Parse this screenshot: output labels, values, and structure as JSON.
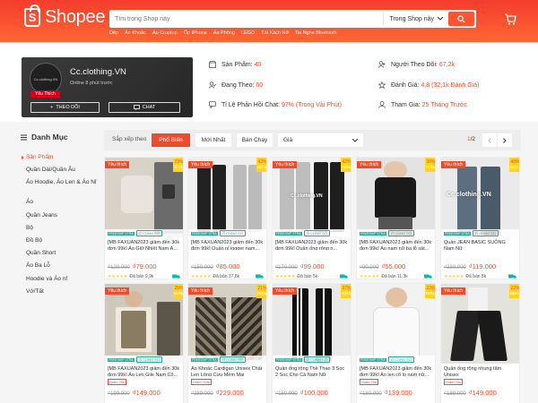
{
  "header": {
    "logo_text": "Shopee",
    "search_placeholder": "Tìm trong Shop này",
    "search_scope": "Trong Shop này",
    "hot_keywords": [
      "Dép",
      "Áo Khoác",
      "Áo Croptop",
      "Ốp iPhone",
      "Áo Phông",
      "LEGO",
      "Túi Xách Nữ",
      "Tai Nghe Bluetooth"
    ]
  },
  "shop": {
    "avatar_text": "Cc.clothing.VN",
    "favorite_badge": "Yêu Thích",
    "name": "Cc.clothing.VN",
    "online": "Online 8 phút trước",
    "follow_label": "THEO DÕI",
    "chat_label": "CHAT",
    "stats": [
      {
        "label": "Sản Phẩm: ",
        "value": "40",
        "icon": "store-icon"
      },
      {
        "label": "Người Theo Dõi: ",
        "value": "67,2k",
        "icon": "followers-icon"
      },
      {
        "label": "Đang Theo: ",
        "value": "60",
        "icon": "following-icon"
      },
      {
        "label": "Đánh Giá: ",
        "value": "4.8 (32,1k Đánh Giá)",
        "icon": "star-icon"
      },
      {
        "label": "Tỉ Lệ Phản Hồi Chat: ",
        "value": "97% (Trong Vài Phút)",
        "icon": "chat-rate-icon"
      },
      {
        "label": "Tham Gia: ",
        "value": "25 Tháng Trước",
        "icon": "joined-icon"
      }
    ]
  },
  "sidebar": {
    "title": "Danh Mục",
    "items": [
      "Sản Phẩm",
      "Quần Dài/Quần Âu",
      "Áo Hoodie, Áo Len & Áo Nỉ",
      "Áo",
      "Quần Jeans",
      "Bộ",
      "Đồ Bộ",
      "Quần Short",
      "Áo Ba Lỗ",
      "Hoodie và Áo nỉ",
      "Vớ/Tất"
    ]
  },
  "sort": {
    "label": "Sắp xếp theo",
    "options": [
      "Phổ Biến",
      "Mới Nhất",
      "Bán Chạy"
    ],
    "active": "Phổ Biến",
    "price_select": "Giá",
    "page_current": "1",
    "page_total": "/2"
  },
  "accent": "#ee4d2d",
  "products": [
    {
      "title": "[MB FAXUAN2023 giảm đến 30k đơn 99k] Áo Giữ Nhiệt Nam Á...",
      "fav": "Yêu thích",
      "discount": "23%",
      "disc_word": "GIẢM",
      "free_ship": "FREESHIP XTRA",
      "badge": "Ở CÙNG SỐ",
      "old": "₫129.000",
      "price": "₫79.000",
      "sold": "Đã bán 9,9k",
      "vouchers": []
    },
    {
      "title": "[MB FAXUAN2023 giảm đến 30k đơn 99k] Quần nỉ jogger nam...",
      "fav": "Yêu thích",
      "discount": "43%",
      "disc_word": "GIẢM",
      "free_ship": "FREESHIP XTRA",
      "badge": "Ở CÙNG SỐ",
      "old": "₫150.000",
      "price": "₫85.000",
      "sold": "Đã bán 37,8k",
      "vouchers": []
    },
    {
      "title": "[MB FAXUAN2023 giảm đến 30k đơn 99k] Quần ống rộng n...",
      "fav": "Yêu thích",
      "discount": "42%",
      "disc_word": "GIẢM",
      "free_ship": "FREESHIP XTRA",
      "badge": "Ở CÙNG SỐ",
      "old": "₫170.000",
      "price": "₫99.000",
      "sold": "Đã bán 5k",
      "vouchers": []
    },
    {
      "title": "[MB FAXUAN2023 giảm đến 30k đơn 99k] Áo nam nữ ba lỗ sát...",
      "fav": "Yêu thích",
      "discount": "38%",
      "disc_word": "GIẢM",
      "free_ship": "FREESHIP XTRA",
      "badge": "Ở CÙNG SỐ",
      "old": "₫90.000",
      "price": "₫55.000",
      "sold": "Đã bán 11,3k",
      "vouchers": []
    },
    {
      "title": "Quần JEAN BASIC SUÔNG Nam Nữ",
      "fav": "Yêu thích",
      "discount": "48%",
      "disc_word": "GIẢM",
      "free_ship": "FREESHIP XTRA",
      "badge": "Ở CÙNG SỐ",
      "old": "₫230.000",
      "price": "₫119.000",
      "sold": "Đã bán 8k",
      "vouchers": []
    },
    {
      "title": "[MB FAXUAN2023 giảm đến 30k đơn 99k] Áo Len Gile Nam Cổ...",
      "fav": "Yêu thích",
      "discount": "25%",
      "disc_word": "GIẢM",
      "free_ship": "FREESHIP XTRA",
      "badge": "Ở CÙNG SỐ",
      "old": "₫199.000",
      "price": "₫149.000",
      "sold": "",
      "vouchers": [
        "Giảm ₫5k"
      ]
    },
    {
      "title": "Áo Khoác Cardigan Unisex Chất Len Lông Cừu Mềm Mại",
      "fav": "Yêu thích",
      "discount": "21%",
      "disc_word": "GIẢM",
      "free_ship": "FREESHIP XTRA",
      "badge": "Ở CÙNG SỐ",
      "old": "₫289.000",
      "price": "₫229.000",
      "sold": "",
      "vouchers": [
        "Giảm ₫10k"
      ]
    },
    {
      "title": "Quần ống rộng Thể Thao 3 Sọc 2 Sọc Cho Cả Nam Nữ",
      "fav": "Yêu thích",
      "discount": "37%",
      "disc_word": "GIẢM",
      "free_ship": "FREESHIP XTRA",
      "badge": "Ở CÙNG SỐ",
      "old": "₫159.000",
      "price": "₫100.000",
      "sold": "",
      "vouchers": []
    },
    {
      "title": "[MB FAXUAN2023 giảm đến 30k đơn 99k] Áo len cổ lọ nam nữ...",
      "fav": "",
      "discount": "23%",
      "disc_word": "GIẢM",
      "free_ship": "FREESHIP XTRA",
      "badge": "Ở CÙNG SỐ",
      "old": "₫180.000",
      "price": "₫139.000",
      "sold": "",
      "vouchers": [
        "Giảm ₫5k"
      ]
    },
    {
      "title": "Quần ống rộng nhung tăm Unisex",
      "fav": "Yêu thích",
      "discount": "22%",
      "disc_word": "GIẢM",
      "free_ship": "",
      "badge": "",
      "old": "₫189.000",
      "price": "₫149.000",
      "sold": "",
      "vouchers": [
        "Giảm ₫5k"
      ]
    }
  ]
}
